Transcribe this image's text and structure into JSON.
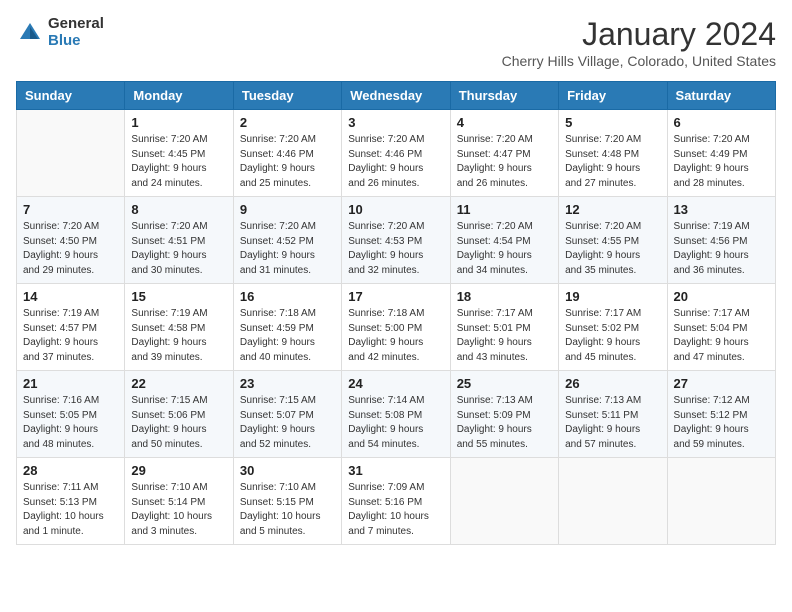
{
  "logo": {
    "general": "General",
    "blue": "Blue"
  },
  "title": "January 2024",
  "location": "Cherry Hills Village, Colorado, United States",
  "days_of_week": [
    "Sunday",
    "Monday",
    "Tuesday",
    "Wednesday",
    "Thursday",
    "Friday",
    "Saturday"
  ],
  "weeks": [
    [
      {
        "day": "",
        "info": ""
      },
      {
        "day": "1",
        "info": "Sunrise: 7:20 AM\nSunset: 4:45 PM\nDaylight: 9 hours\nand 24 minutes."
      },
      {
        "day": "2",
        "info": "Sunrise: 7:20 AM\nSunset: 4:46 PM\nDaylight: 9 hours\nand 25 minutes."
      },
      {
        "day": "3",
        "info": "Sunrise: 7:20 AM\nSunset: 4:46 PM\nDaylight: 9 hours\nand 26 minutes."
      },
      {
        "day": "4",
        "info": "Sunrise: 7:20 AM\nSunset: 4:47 PM\nDaylight: 9 hours\nand 26 minutes."
      },
      {
        "day": "5",
        "info": "Sunrise: 7:20 AM\nSunset: 4:48 PM\nDaylight: 9 hours\nand 27 minutes."
      },
      {
        "day": "6",
        "info": "Sunrise: 7:20 AM\nSunset: 4:49 PM\nDaylight: 9 hours\nand 28 minutes."
      }
    ],
    [
      {
        "day": "7",
        "info": "Sunrise: 7:20 AM\nSunset: 4:50 PM\nDaylight: 9 hours\nand 29 minutes."
      },
      {
        "day": "8",
        "info": "Sunrise: 7:20 AM\nSunset: 4:51 PM\nDaylight: 9 hours\nand 30 minutes."
      },
      {
        "day": "9",
        "info": "Sunrise: 7:20 AM\nSunset: 4:52 PM\nDaylight: 9 hours\nand 31 minutes."
      },
      {
        "day": "10",
        "info": "Sunrise: 7:20 AM\nSunset: 4:53 PM\nDaylight: 9 hours\nand 32 minutes."
      },
      {
        "day": "11",
        "info": "Sunrise: 7:20 AM\nSunset: 4:54 PM\nDaylight: 9 hours\nand 34 minutes."
      },
      {
        "day": "12",
        "info": "Sunrise: 7:20 AM\nSunset: 4:55 PM\nDaylight: 9 hours\nand 35 minutes."
      },
      {
        "day": "13",
        "info": "Sunrise: 7:19 AM\nSunset: 4:56 PM\nDaylight: 9 hours\nand 36 minutes."
      }
    ],
    [
      {
        "day": "14",
        "info": "Sunrise: 7:19 AM\nSunset: 4:57 PM\nDaylight: 9 hours\nand 37 minutes."
      },
      {
        "day": "15",
        "info": "Sunrise: 7:19 AM\nSunset: 4:58 PM\nDaylight: 9 hours\nand 39 minutes."
      },
      {
        "day": "16",
        "info": "Sunrise: 7:18 AM\nSunset: 4:59 PM\nDaylight: 9 hours\nand 40 minutes."
      },
      {
        "day": "17",
        "info": "Sunrise: 7:18 AM\nSunset: 5:00 PM\nDaylight: 9 hours\nand 42 minutes."
      },
      {
        "day": "18",
        "info": "Sunrise: 7:17 AM\nSunset: 5:01 PM\nDaylight: 9 hours\nand 43 minutes."
      },
      {
        "day": "19",
        "info": "Sunrise: 7:17 AM\nSunset: 5:02 PM\nDaylight: 9 hours\nand 45 minutes."
      },
      {
        "day": "20",
        "info": "Sunrise: 7:17 AM\nSunset: 5:04 PM\nDaylight: 9 hours\nand 47 minutes."
      }
    ],
    [
      {
        "day": "21",
        "info": "Sunrise: 7:16 AM\nSunset: 5:05 PM\nDaylight: 9 hours\nand 48 minutes."
      },
      {
        "day": "22",
        "info": "Sunrise: 7:15 AM\nSunset: 5:06 PM\nDaylight: 9 hours\nand 50 minutes."
      },
      {
        "day": "23",
        "info": "Sunrise: 7:15 AM\nSunset: 5:07 PM\nDaylight: 9 hours\nand 52 minutes."
      },
      {
        "day": "24",
        "info": "Sunrise: 7:14 AM\nSunset: 5:08 PM\nDaylight: 9 hours\nand 54 minutes."
      },
      {
        "day": "25",
        "info": "Sunrise: 7:13 AM\nSunset: 5:09 PM\nDaylight: 9 hours\nand 55 minutes."
      },
      {
        "day": "26",
        "info": "Sunrise: 7:13 AM\nSunset: 5:11 PM\nDaylight: 9 hours\nand 57 minutes."
      },
      {
        "day": "27",
        "info": "Sunrise: 7:12 AM\nSunset: 5:12 PM\nDaylight: 9 hours\nand 59 minutes."
      }
    ],
    [
      {
        "day": "28",
        "info": "Sunrise: 7:11 AM\nSunset: 5:13 PM\nDaylight: 10 hours\nand 1 minute."
      },
      {
        "day": "29",
        "info": "Sunrise: 7:10 AM\nSunset: 5:14 PM\nDaylight: 10 hours\nand 3 minutes."
      },
      {
        "day": "30",
        "info": "Sunrise: 7:10 AM\nSunset: 5:15 PM\nDaylight: 10 hours\nand 5 minutes."
      },
      {
        "day": "31",
        "info": "Sunrise: 7:09 AM\nSunset: 5:16 PM\nDaylight: 10 hours\nand 7 minutes."
      },
      {
        "day": "",
        "info": ""
      },
      {
        "day": "",
        "info": ""
      },
      {
        "day": "",
        "info": ""
      }
    ]
  ]
}
